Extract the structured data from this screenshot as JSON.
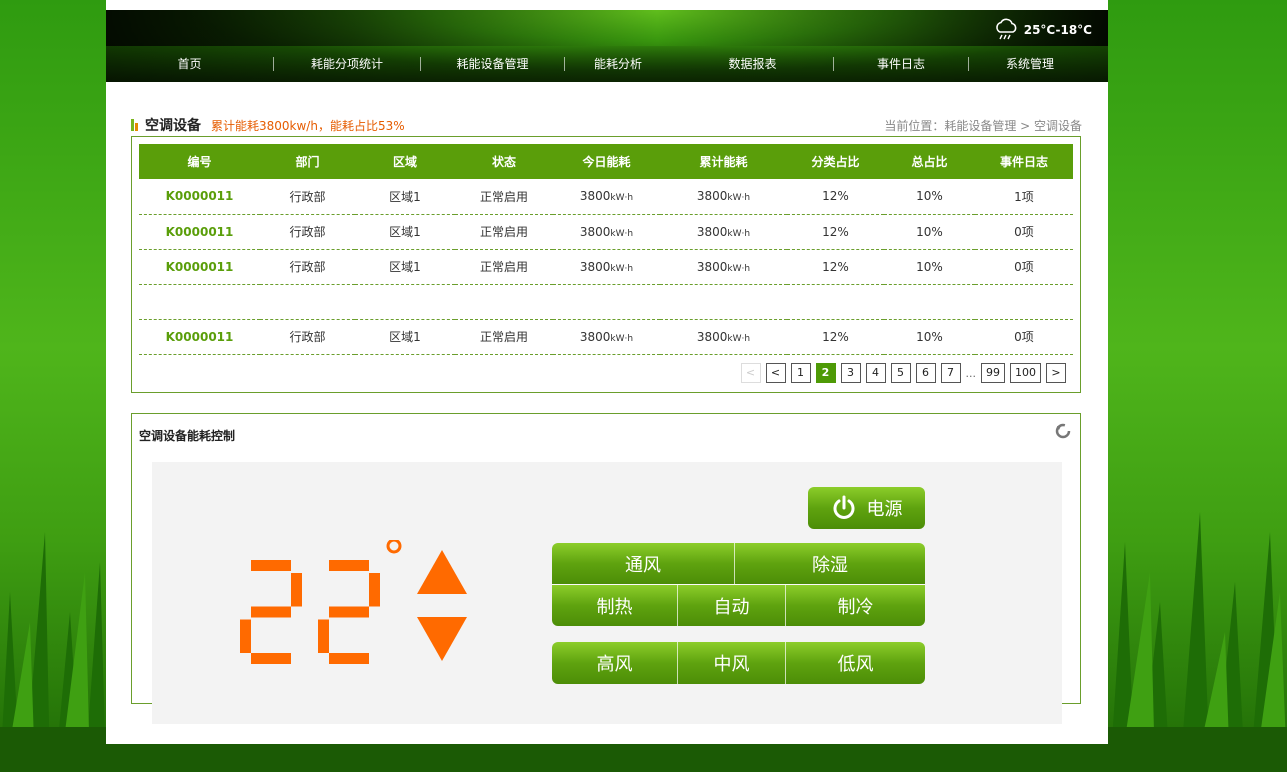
{
  "weather": {
    "icon": "cloud-rain-icon",
    "text": "25°C-18°C"
  },
  "nav": [
    {
      "label": "首页"
    },
    {
      "label": "耗能分项统计"
    },
    {
      "label": "耗能设备管理"
    },
    {
      "label": "能耗分析"
    },
    {
      "label": "数据报表"
    },
    {
      "label": "事件日志"
    },
    {
      "label": "系统管理"
    }
  ],
  "section": {
    "title": "空调设备",
    "summary": "累计能耗3800kw/h，能耗占比53%",
    "breadcrumb": "当前位置：耗能设备管理 > 空调设备"
  },
  "table": {
    "headers": [
      "编号",
      "部门",
      "区域",
      "状态",
      "今日能耗",
      "累计能耗",
      "分类占比",
      "总占比",
      "事件日志"
    ],
    "rows": [
      {
        "code": "K0000011",
        "dept": "行政部",
        "area": "区域1",
        "status": "正常启用",
        "today": "3800",
        "today_unit": "kW·h",
        "total": "3800",
        "total_unit": "kW·h",
        "cat_ratio": "12%",
        "total_ratio": "10%",
        "events": "1项"
      },
      {
        "code": "K0000011",
        "dept": "行政部",
        "area": "区域1",
        "status": "正常启用",
        "today": "3800",
        "today_unit": "kW·h",
        "total": "3800",
        "total_unit": "kW·h",
        "cat_ratio": "12%",
        "total_ratio": "10%",
        "events": "0项"
      },
      {
        "code": "K0000011",
        "dept": "行政部",
        "area": "区域1",
        "status": "正常启用",
        "today": "3800",
        "today_unit": "kW·h",
        "total": "3800",
        "total_unit": "kW·h",
        "cat_ratio": "12%",
        "total_ratio": "10%",
        "events": "0项"
      },
      {
        "code": "",
        "dept": "",
        "area": "",
        "status": "",
        "today": "",
        "today_unit": "",
        "total": "",
        "total_unit": "",
        "cat_ratio": "",
        "total_ratio": "",
        "events": ""
      },
      {
        "code": "K0000011",
        "dept": "行政部",
        "area": "区域1",
        "status": "正常启用",
        "today": "3800",
        "today_unit": "kW·h",
        "total": "3800",
        "total_unit": "kW·h",
        "cat_ratio": "12%",
        "total_ratio": "10%",
        "events": "0项"
      }
    ]
  },
  "pager": {
    "first": "<",
    "prev": "<",
    "pages": [
      "1",
      "2",
      "3",
      "4",
      "5",
      "6",
      "7"
    ],
    "current": "2",
    "ellipsis": "...",
    "tail": [
      "99",
      "100"
    ],
    "next": ">"
  },
  "control": {
    "title": "空调设备能耗控制",
    "temperature": "22",
    "temperature_unit": "°",
    "power_label": "电源",
    "mode_row1": [
      "通风",
      "除湿"
    ],
    "mode_row2": [
      "制热",
      "自动",
      "制冷"
    ],
    "fan_row": [
      "高风",
      "中风",
      "低风"
    ]
  },
  "colors": {
    "accent": "#5a9e0a",
    "highlight": "#ff6a00",
    "summary": "#e65c00"
  }
}
